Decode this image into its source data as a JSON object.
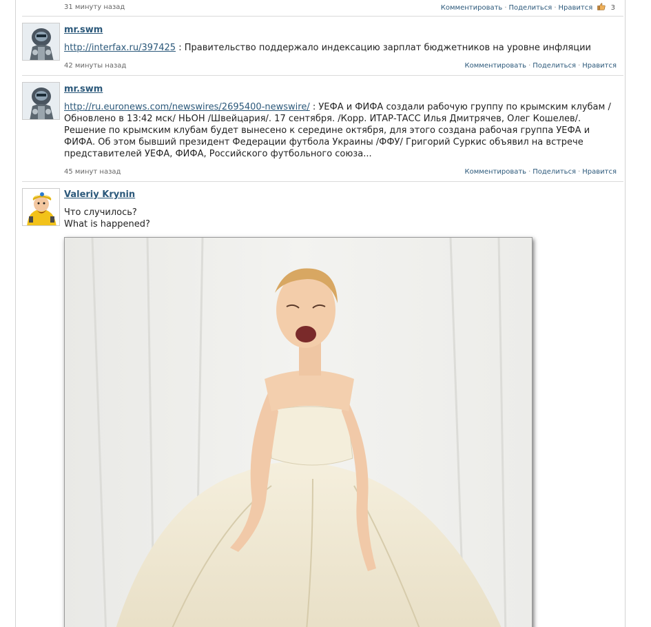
{
  "colors": {
    "link": "#2b587a",
    "meta": "#666666",
    "divider": "#dadada"
  },
  "top_meta": {
    "time": "31 минуту назад",
    "comment": "Комментировать",
    "share": "Поделиться",
    "like": "Нравится",
    "like_count": "3"
  },
  "posts": [
    {
      "author": "mr.swm",
      "link": "http://interfax.ru/397425",
      "text": " : Правительство поддержало индексацию зарплат бюджетников на уровне инфляции",
      "time": "42 минуты назад",
      "comment": "Комментировать",
      "share": "Поделиться",
      "like": "Нравится",
      "avatar_icon": "robot-avatar-icon"
    },
    {
      "author": "mr.swm",
      "link": "http://ru.euronews.com/newswires/2695400-newswire/",
      "text": " : УЕФА и ФИФА создали рабочую группу по крымским клубам / Обновлено в 13:42 мск/ НЬОН /Швейцария/. 17 сентября. /Корр. ИТАР-ТАСС Илья Дмитрячев, Олег Кошелев/. Решение по крымским клубам будет вынесено к середине октября, для этого создана рабочая группа УЕФА и ФИФА. Об этом бывший президент Федерации футбола Украины /ФФУ/ Григорий Суркис объявил на встрече представителей УЕФА, ФИФА, Российского футбольного союза...",
      "time": "45 минут назад",
      "comment": "Комментировать",
      "share": "Поделиться",
      "like": "Нравится",
      "avatar_icon": "robot-avatar-icon"
    },
    {
      "author": "Valeriy Krynin",
      "line1": "Что случилось?",
      "line2": "What is happened?",
      "avatar_icon": "cartoon-dwarf-avatar-icon",
      "photo": "crying-bride-photo"
    }
  ]
}
